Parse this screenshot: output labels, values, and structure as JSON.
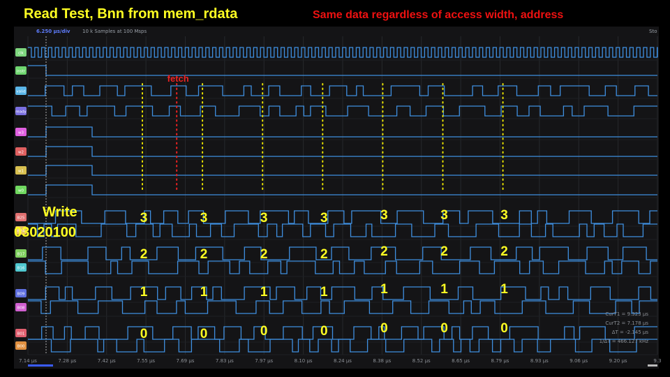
{
  "title": "Read Test, Bnn from mem_rdata",
  "subtitle": "Same data regardless of access width, address",
  "scope": {
    "timebase": "6.250 µs/div",
    "samples": "10 k Samples at 100 Msps",
    "status": "Sto"
  },
  "annotations": {
    "fetch": "fetch",
    "write_label": "Write",
    "write_value": "03020100"
  },
  "cursors": [
    {
      "label": "CurT1 =",
      "value": "9.323 µs"
    },
    {
      "label": "CurT2 =",
      "value": "7.178 µs"
    },
    {
      "label": "ΔT =",
      "value": "-2.145 µs"
    },
    {
      "label": "1/ΔT =",
      "value": "466.127 kHz"
    }
  ],
  "colors": {
    "trace": "#3f8fe0",
    "title": "#ffff22",
    "subtitle": "#ee1111",
    "marker_read": "#e8e200",
    "marker_fetch": "#ee2222",
    "digit": "#ffff22"
  },
  "chart_data": {
    "type": "line",
    "title": "Read Test, Bnn from mem_rdata",
    "subtitle": "Same data regardless of access width, address",
    "xlabel": "",
    "ylabel": "",
    "x_unit": "µs",
    "x_ticks": [
      "7.14 µs",
      "7.28 µs",
      "7.42 µs",
      "7.55 µs",
      "7.69 µs",
      "7.83 µs",
      "7.97 µs",
      "8.10 µs",
      "8.24 µs",
      "8.38 µs",
      "8.52 µs",
      "8.65 µs",
      "8.79 µs",
      "8.93 µs",
      "9.06 µs",
      "9.20 µs",
      "9.3"
    ],
    "xlim": [
      7.14,
      9.34
    ],
    "channels": [
      {
        "name": "clk",
        "color": "#7ed67e"
      },
      {
        "name": "instr",
        "color": "#6fd66f"
      },
      {
        "name": "valid",
        "color": "#5ab6e8"
      },
      {
        "name": "ready",
        "color": "#7a6fe0"
      },
      {
        "name": "w3",
        "color": "#e060e0"
      },
      {
        "name": "w2",
        "color": "#e06060"
      },
      {
        "name": "w1",
        "color": "#d8c050"
      },
      {
        "name": "w0",
        "color": "#70d860"
      },
      {
        "name": "B25",
        "color": "#e07070"
      },
      {
        "name": "B24",
        "color": "#e8c060"
      },
      {
        "name": "B17",
        "color": "#80d060"
      },
      {
        "name": "B16",
        "color": "#50c8d0"
      },
      {
        "name": "B09",
        "color": "#6070e0"
      },
      {
        "name": "B08",
        "color": "#d060d0"
      },
      {
        "name": "B01",
        "color": "#e06070"
      },
      {
        "name": "B00",
        "color": "#e09040"
      }
    ],
    "markers": [
      {
        "time": 7.54,
        "kind": "read",
        "digits": [
          3,
          2,
          1,
          0
        ]
      },
      {
        "time": 7.66,
        "kind": "fetch",
        "digits": []
      },
      {
        "time": 7.75,
        "kind": "read",
        "digits": [
          3,
          2,
          1,
          0
        ]
      },
      {
        "time": 7.96,
        "kind": "read",
        "digits": [
          3,
          2,
          1,
          0
        ]
      },
      {
        "time": 8.17,
        "kind": "read",
        "digits": [
          3,
          2,
          1,
          0
        ]
      },
      {
        "time": 8.38,
        "kind": "read",
        "digits": [
          3,
          2,
          1,
          0
        ]
      },
      {
        "time": 8.59,
        "kind": "read",
        "digits": [
          3,
          2,
          1,
          0
        ]
      },
      {
        "time": 8.8,
        "kind": "read",
        "digits": [
          3,
          2,
          1,
          0
        ]
      }
    ],
    "grid": true,
    "legend": "left"
  }
}
